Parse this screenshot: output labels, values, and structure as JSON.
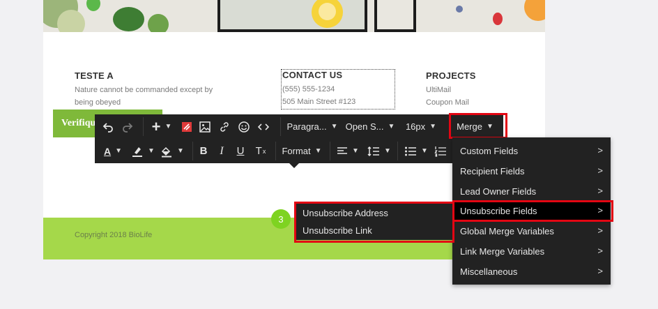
{
  "footer_columns": {
    "left": {
      "title": "TESTE A",
      "line1": "Nature cannot be commanded except by",
      "line2": "being obeyed"
    },
    "contact": {
      "title": "CONTACT US",
      "phone": "(555) 555-1234",
      "address": "505 Main Street #123"
    },
    "projects": {
      "title": "PROJECTS",
      "item1": "UltiMail",
      "item2": "Coupon Mail"
    }
  },
  "verify_button": {
    "label": "Verifiqu"
  },
  "footer": {
    "copyright": "Copyright 2018 BioLife"
  },
  "toolbar": {
    "paragraph": "Paragra...",
    "font": "Open S...",
    "size": "16px",
    "merge": "Merge",
    "format": "Format",
    "icons": [
      "undo-icon",
      "redo-icon",
      "insert-plus-icon",
      "special-block-icon",
      "image-icon",
      "link-icon",
      "emoji-icon",
      "code-icon",
      "text-color-icon",
      "highlight-icon",
      "fill-color-icon",
      "bold-icon",
      "italic-icon",
      "underline-icon",
      "clear-format-icon",
      "align-icon",
      "line-height-icon",
      "bullet-list-icon",
      "numbered-list-icon"
    ]
  },
  "merge_menu": {
    "items": [
      {
        "label": "Custom Fields"
      },
      {
        "label": "Recipient Fields"
      },
      {
        "label": "Lead Owner Fields"
      },
      {
        "label": "Unsubscribe Fields"
      },
      {
        "label": "Global Merge Variables"
      },
      {
        "label": "Link Merge Variables"
      },
      {
        "label": "Miscellaneous"
      }
    ],
    "active_index": 3
  },
  "submenu": {
    "items": [
      {
        "label": "Unsubscribe Address"
      },
      {
        "label": "Unsubscribe Link"
      }
    ]
  },
  "step_badge": "3",
  "colors": {
    "highlight": "#e30613",
    "footer": "#a5d84a",
    "button": "#7fb93a",
    "toolbar": "#222222",
    "step": "#7ed321"
  }
}
